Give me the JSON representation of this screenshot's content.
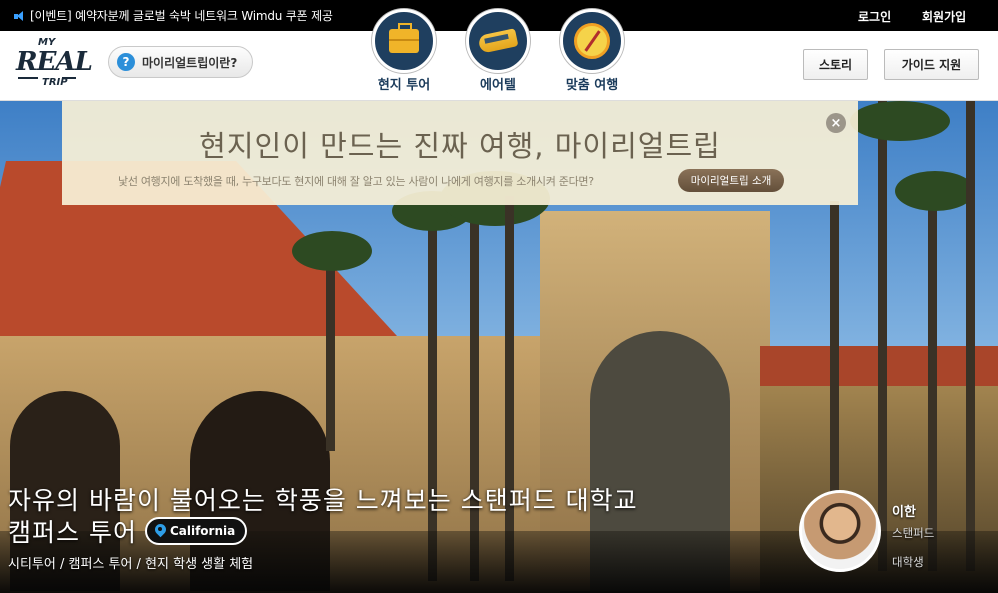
{
  "topbar": {
    "notice": "[이벤트] 예약자분께 글로벌 숙박 네트워크 Wimdu 쿠폰 제공",
    "login": "로그인",
    "signup": "회원가입"
  },
  "header": {
    "logo": {
      "my": "MY",
      "real": "REAL",
      "trip": "TRIP"
    },
    "what_button": "마이리얼트립이란?",
    "categories": [
      {
        "label": "현지 투어",
        "icon": "suitcase-icon"
      },
      {
        "label": "에어텔",
        "icon": "train-icon"
      },
      {
        "label": "맞춤 여행",
        "icon": "compass-icon"
      }
    ],
    "story_button": "스토리",
    "guide_button": "가이드 지원"
  },
  "banner": {
    "headline": "현지인이 만드는 진짜 여행, 마이리얼트립",
    "subtext": "낯선 여행지에 도착했을 때, 누구보다도 현지에 대해 잘 알고 있는 사람이 나에게 여행지를 소개시켜 준다면?",
    "intro_button": "마이리얼트립 소개",
    "close": "×"
  },
  "hero": {
    "title_line1": "자유의 바람이 불어오는 학풍을 느껴보는 스탠퍼드 대학교",
    "title_line2": "캠퍼스 투어",
    "location": "California",
    "tags": "시티투어 / 캠퍼스 투어 / 현지 학생 생활 체험",
    "guide": {
      "name": "이한",
      "org": "스탠퍼드",
      "role": "대학생"
    }
  }
}
